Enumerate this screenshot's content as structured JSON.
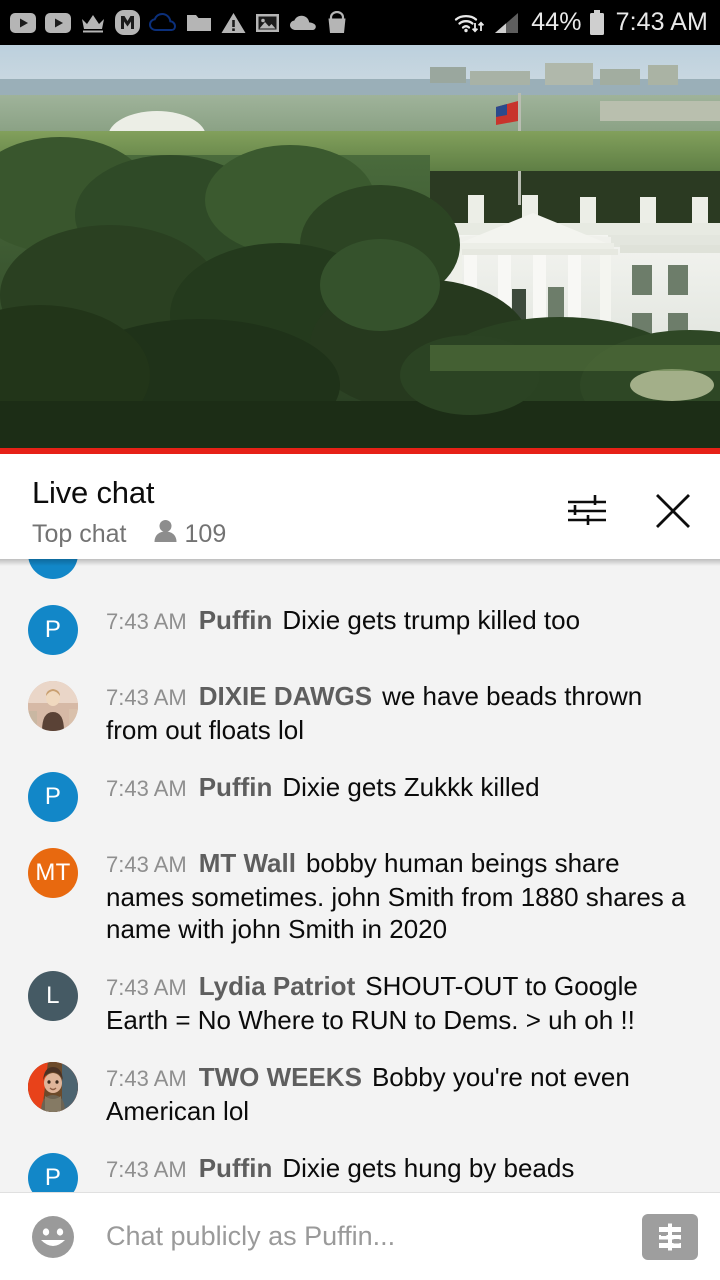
{
  "statusbar": {
    "icons": [
      {
        "name": "youtube-play-icon"
      },
      {
        "name": "youtube-play-icon"
      },
      {
        "name": "crown-icon"
      },
      {
        "name": "m-logo-icon"
      },
      {
        "name": "cloud-outline-icon"
      },
      {
        "name": "folder-icon"
      },
      {
        "name": "warning-triangle-icon"
      },
      {
        "name": "image-icon"
      },
      {
        "name": "cloud-icon"
      },
      {
        "name": "shopping-bag-icon"
      }
    ],
    "wifi_icon": "wifi-data-icon",
    "signal_icon": "signal-bars-icon",
    "battery_percent": "44%",
    "battery_icon": "battery-icon",
    "time": "7:43 AM"
  },
  "video": {
    "alt": "White House live stream",
    "progress_color": "#e62117",
    "progress_percent": 100
  },
  "chat_header": {
    "title": "Live chat",
    "mode": "Top chat",
    "viewer_icon": "person-icon",
    "viewer_count": "109",
    "settings_icon": "tune-sliders-icon",
    "close_icon": "close-x-icon"
  },
  "messages": [
    {
      "id": "m0",
      "partial": true,
      "time": "",
      "author": "",
      "text": "",
      "avatar": {
        "type": "initial",
        "initials": "",
        "color": "#1287c8"
      }
    },
    {
      "id": "m1",
      "partial": false,
      "time": "7:43 AM",
      "author": "Puffin",
      "text": "Dixie gets trump killed too",
      "avatar": {
        "type": "initial",
        "initials": "P",
        "color": "#1287c8"
      }
    },
    {
      "id": "m2",
      "partial": false,
      "time": "7:43 AM",
      "author": "DIXIE DAWGS",
      "text": "we have beads thrown from out floats lol",
      "avatar": {
        "type": "photo",
        "photo": "woman-light-photo",
        "color": "#d8b9a8"
      }
    },
    {
      "id": "m3",
      "partial": false,
      "time": "7:43 AM",
      "author": "Puffin",
      "text": "Dixie gets Zukkk killed",
      "avatar": {
        "type": "initial",
        "initials": "P",
        "color": "#1287c8"
      }
    },
    {
      "id": "m4",
      "partial": false,
      "time": "7:43 AM",
      "author": "MT Wall",
      "text": "bobby human beings share names sometimes. john Smith from 1880 shares a name with john Smith in 2020",
      "avatar": {
        "type": "initial",
        "initials": "MT",
        "color": "#e8690f"
      }
    },
    {
      "id": "m5",
      "partial": false,
      "time": "7:43 AM",
      "author": "Lydia Patriot",
      "text": "SHOUT-OUT to Google Earth = No Where to RUN to Dems. > uh oh !!",
      "avatar": {
        "type": "initial",
        "initials": "L",
        "color": "#455a64"
      }
    },
    {
      "id": "m6",
      "partial": false,
      "time": "7:43 AM",
      "author": "TWO WEEKS",
      "text": "Bobby you're not even American lol",
      "avatar": {
        "type": "photo",
        "photo": "person-red-photo",
        "color": "#b33a1c"
      }
    },
    {
      "id": "m7",
      "partial": false,
      "time": "7:43 AM",
      "author": "Puffin",
      "text": "Dixie gets hung by beads",
      "avatar": {
        "type": "initial",
        "initials": "P",
        "color": "#1287c8"
      }
    }
  ],
  "input_bar": {
    "emoji_icon": "emoji-smiley-icon",
    "placeholder": "Chat publicly as Puffin...",
    "value": "",
    "money_icon": "super-chat-dollar-icon"
  },
  "colors": {
    "accent_red": "#e62117",
    "chat_bg": "#f3f3f3",
    "header_bg": "#ffffff",
    "status_bg": "#000000"
  }
}
